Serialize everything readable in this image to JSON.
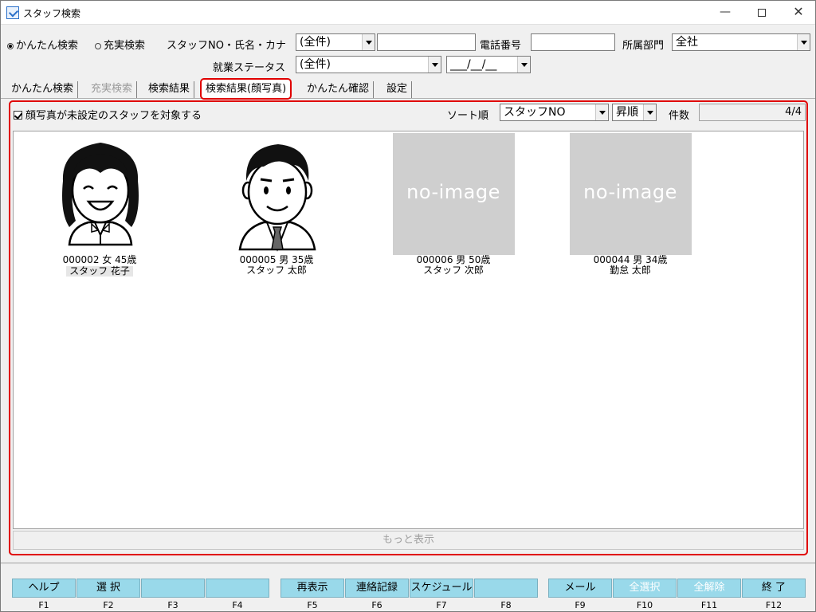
{
  "window": {
    "title": "スタッフ検索",
    "minimize": "—",
    "close": "✕"
  },
  "search": {
    "mode_easy": "かんたん検索",
    "mode_full": "充実検索",
    "staff_label": "スタッフNO・氏名・カナ",
    "staff_combo": "(全件)",
    "staff_text": "",
    "phone_label": "電話番号",
    "phone_value": "",
    "dept_label": "所属部門",
    "dept_value": "全社",
    "status_label": "就業ステータス",
    "status_value": "(全件)",
    "date_value": "___/__/__"
  },
  "tabs": [
    {
      "label": "かんたん検索"
    },
    {
      "label": "充実検索"
    },
    {
      "label": "検索結果"
    },
    {
      "label": "検索結果(顔写真)"
    },
    {
      "label": "かんたん確認"
    },
    {
      "label": "設定"
    }
  ],
  "panel": {
    "checkbox_label": "顔写真が未設定のスタッフを対象する",
    "sort_label": "ソート順",
    "sort_value": "スタッフNO",
    "order_value": "昇順",
    "count_label": "件数",
    "count_value": "4/4",
    "more_label": "もっと表示",
    "no_image_text": "no-image"
  },
  "staff": [
    {
      "line1": "000002  女  45歳",
      "line2": "スタッフ  花子",
      "photo": "female-avatar"
    },
    {
      "line1": "000005  男  35歳",
      "line2": "スタッフ  太郎",
      "photo": "male-avatar"
    },
    {
      "line1": "000006  男  50歳",
      "line2": "スタッフ  次郎",
      "photo": "no-image"
    },
    {
      "line1": "000044  男  34歳",
      "line2": "勤怠  太郎",
      "photo": "no-image"
    }
  ],
  "function_keys": [
    {
      "label": "ヘルプ",
      "key": "F1"
    },
    {
      "label": "選 択",
      "key": "F2"
    },
    {
      "label": "",
      "key": "F3"
    },
    {
      "label": "",
      "key": "F4"
    },
    {
      "label": "再表示",
      "key": "F5"
    },
    {
      "label": "連絡記録",
      "key": "F6"
    },
    {
      "label": "スケジュール",
      "key": "F7"
    },
    {
      "label": "",
      "key": "F8"
    },
    {
      "label": "メール",
      "key": "F9"
    },
    {
      "label": "全選択",
      "key": "F10"
    },
    {
      "label": "全解除",
      "key": "F11"
    },
    {
      "label": "終 了",
      "key": "F12"
    }
  ],
  "colors": {
    "highlight_red": "#e00000",
    "fkey_blue": "#99d9ea",
    "no_image_gray": "#cfcfcf"
  }
}
